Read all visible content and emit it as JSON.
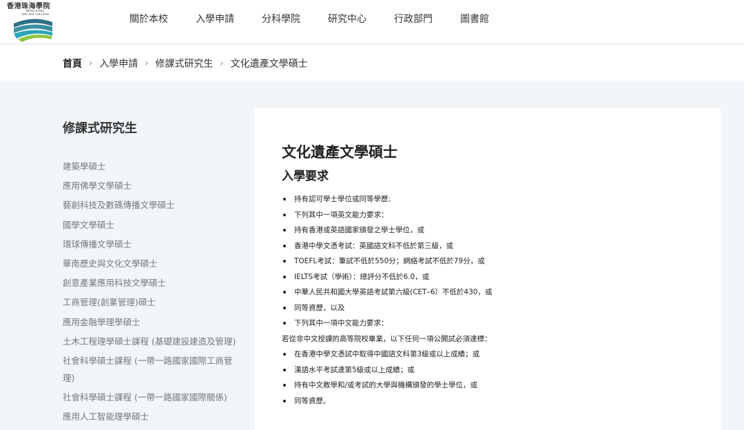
{
  "logo": {
    "name_cn": "香港珠海學院",
    "name_en_line1": "HONG KONG",
    "name_en_line2": "CHU HAI COLLEGE",
    "colors": [
      "#2f6f86",
      "#2aa6b8",
      "#8cc63f"
    ]
  },
  "nav": {
    "items": [
      "關於本校",
      "入學申請",
      "分科學院",
      "研究中心",
      "行政部門",
      "圖書館"
    ]
  },
  "breadcrumb": {
    "home": "首頁",
    "items": [
      "入學申請",
      "修課式研究生",
      "文化遺產文學碩士"
    ],
    "separator_icon": "chevron-right-icon"
  },
  "sidebar": {
    "title": "修課式研究生",
    "items": [
      "建築學碩士",
      "應用佛學文學碩士",
      "藝創科技及數碼傳播文學碩士",
      "國學文學碩士",
      "環球傳播文學碩士",
      "華南歷史與文化文學碩士",
      "創意產業應用科技文學碩士",
      "工商管理(創業管理)碩士",
      "應用金融學理學碩士",
      "土木工程理學碩士課程 (基礎建設建造及管理)",
      "社會科學碩士課程 (一帶一路國家國際工商管理)",
      "社會科學碩士課程 (一帶一路國家國際關係)",
      "應用人工智能理學碩士"
    ]
  },
  "main": {
    "title": "文化遺產文學碩士",
    "section_title": "入學要求",
    "requirements_a": [
      "持有認可學士學位或同等學歷;",
      "下列其中一項英文能力要求：",
      "持有香港或英語國家頒發之學士學位，或",
      "香港中學文憑考試：英國語文科不低於第三級，或",
      "TOEFL考試：筆試不低於550分；網絡考試不低於79分，或",
      "IELTS考試（學術）：總評分不低於6.0，或",
      "中華人民共和國大學英語考試第六級(CET–6）不低於430，或",
      "同等資歷，以及",
      "下列其中一項中文能力要求："
    ],
    "note": "若從非中文授課的高等院校畢業，以下任何一項公開試必須達標：",
    "requirements_b": [
      "在香港中學文憑試中取得中國語文科第3級或以上成績；或",
      "漢語水平考試達第5級或以上成績；或",
      "持有中文教學和/或考試的大學與機構頒發的學士學位，或",
      "同等資歷。"
    ]
  }
}
